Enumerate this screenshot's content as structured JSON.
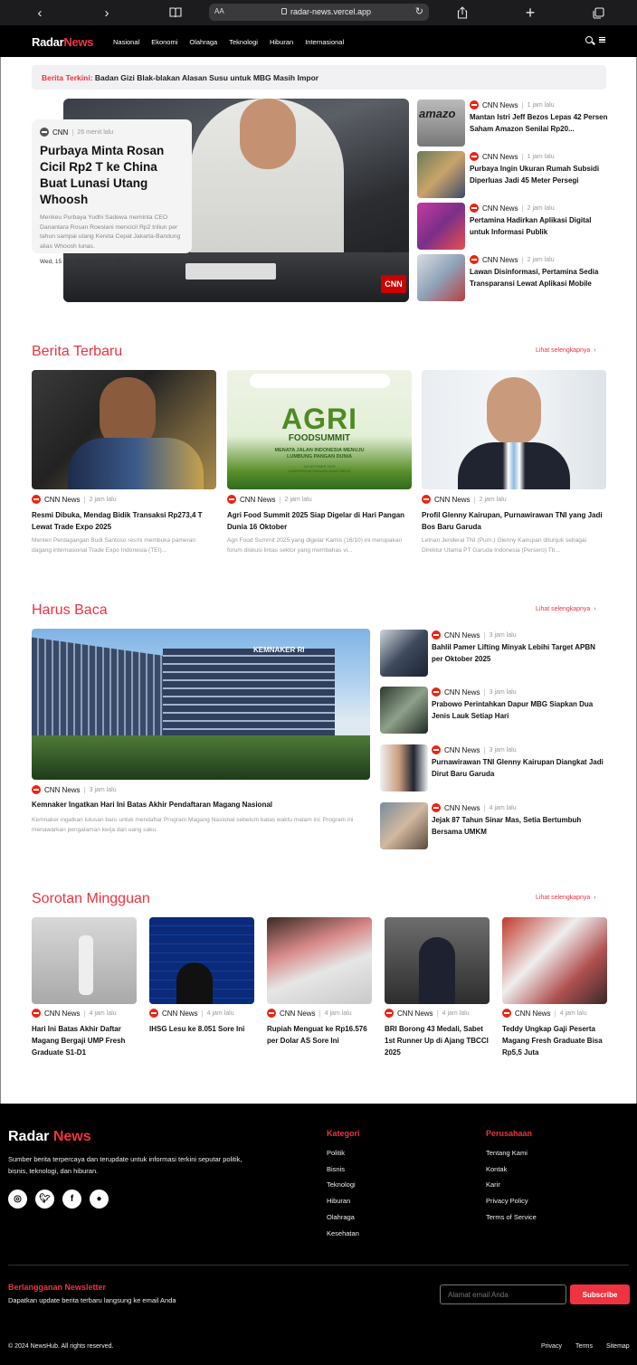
{
  "browser": {
    "aa": "AA",
    "url": "radar-news.vercel.app"
  },
  "brand": {
    "name_a": "Radar",
    "name_b": "News",
    "accent": "#ef3340"
  },
  "nav": [
    "Nasional",
    "Ekonomi",
    "Olahraga",
    "Teknologi",
    "Hiburan",
    "Internasional"
  ],
  "breaking": {
    "label": "Berita Terkini:",
    "text": "Badan Gizi Blak-blakan Alasan Susu untuk MBG Masih Impor"
  },
  "hero": {
    "source": "CNN",
    "time": "26 menit lalu",
    "title": "Purbaya Minta Rosan Cicil Rp2 T ke China Buat Lunasi Utang Whoosh",
    "summary": "Menkeu Purbaya Yudhi Sadewa meminta CEO Danantara Rosan Roeslani mencicil Rp2 triliun per tahun sampai utang Kereta Cepat Jakarta-Bandung alias Whoosh lunas.",
    "date": "Wed, 15 Oct 2025 19:52:03 +0700"
  },
  "hero_side": [
    {
      "source": "CNN News",
      "time": "1 jam lalu",
      "title": "Mantan Istri Jeff Bezos Lepas 42 Persen Saham Amazon Senilai Rp20..."
    },
    {
      "source": "CNN News",
      "time": "1 jam lalu",
      "title": "Purbaya Ingin Ukuran Rumah Subsidi Diperluas Jadi 45 Meter Persegi"
    },
    {
      "source": "CNN News",
      "time": "2 jam lalu",
      "title": "Pertamina Hadirkan Aplikasi Digital untuk Informasi Publik"
    },
    {
      "source": "CNN News",
      "time": "2 jam lalu",
      "title": "Lawan Disinformasi, Pertamina Sedia Transparansi Lewat Aplikasi Mobile"
    }
  ],
  "see_all": "Lihat selengkapnya",
  "terbaru": {
    "title": "Berita Terbaru",
    "items": [
      {
        "source": "CNN News",
        "time": "2 jam lalu",
        "title": "Resmi Dibuka, Mendag Bidik Transaksi Rp273,4 T Lewat Trade Expo 2025",
        "summary": "Menteri Perdagangan Budi Santoso resmi membuka pameran dagang internasional Trade Expo Indonesia (TEI)..."
      },
      {
        "source": "CNN News",
        "time": "2 jam lalu",
        "title": "Agri Food Summit 2025 Siap Digelar di Hari Pangan Dunia 16 Oktober",
        "summary": "Agri Food Summit 2025 yang digelar Kamis (16/10) ini merupakan forum diskusi lintas sektor yang membahas vi..."
      },
      {
        "source": "CNN News",
        "time": "2 jam lalu",
        "title": "Profil Glenny Kairupan, Purnawirawan TNI yang Jadi Bos Baru Garuda",
        "summary": "Letnan Jenderal TNI (Purn.) Glenny Kairupan ditunjuk sebagai Direktur Utama PT Garuda Indonesia (Persero) Tb..."
      }
    ]
  },
  "agri": {
    "headline": "AGRI",
    "sub": "FOODSUMMIT",
    "tag": "MENATA JALAN INDONESIA MENUJU LUMBUNG PANGAN DUNIA",
    "date": "16 OKTOBER 2025",
    "venue": "AUDITORIUM MENARA BANK MEGA"
  },
  "harus_baca": {
    "title": "Harus Baca",
    "main": {
      "source": "CNN News",
      "time": "3 jam lalu",
      "title": "Kemnaker Ingatkan Hari Ini Batas Akhir Pendaftaran Magang Nasional",
      "summary": "Kemnaker ingatkan lulusan baru untuk mendaftar Program Magang Nasional sebelum batas waktu malam ini. Program ini menawarkan pengalaman kerja dan uang saku.",
      "building_sign": "KEMNAKER RI"
    },
    "side": [
      {
        "source": "CNN News",
        "time": "3 jam lalu",
        "title": "Bahlil Pamer Lifting Minyak Lebihi Target APBN per Oktober 2025"
      },
      {
        "source": "CNN News",
        "time": "3 jam lalu",
        "title": "Prabowo Perintahkan Dapur MBG Siapkan Dua Jenis Lauk Setiap Hari"
      },
      {
        "source": "CNN News",
        "time": "3 jam lalu",
        "title": "Purnawirawan TNI Glenny Kairupan Diangkat Jadi Dirut Baru Garuda"
      },
      {
        "source": "CNN News",
        "time": "4 jam lalu",
        "title": "Jejak 87 Tahun Sinar Mas, Setia Bertumbuh Bersama UMKM"
      }
    ]
  },
  "sorotan": {
    "title": "Sorotan Mingguan",
    "items": [
      {
        "source": "CNN News",
        "time": "4 jam lalu",
        "title": "Hari Ini Batas Akhir Daftar Magang Bergaji UMP Fresh Graduate S1-D1"
      },
      {
        "source": "CNN News",
        "time": "4 jam lalu",
        "title": "IHSG Lesu ke 8.051 Sore Ini"
      },
      {
        "source": "CNN News",
        "time": "4 jam lalu",
        "title": "Rupiah Menguat ke Rp16.576 per Dolar AS Sore Ini"
      },
      {
        "source": "CNN News",
        "time": "4 jam lalu",
        "title": "BRI Borong 43 Medali, Sabet 1st Runner Up di Ajang TBCCI 2025"
      },
      {
        "source": "CNN News",
        "time": "4 jam lalu",
        "title": "Teddy Ungkap Gaji Peserta Magang Fresh Graduate Bisa Rp5,5 Juta"
      }
    ]
  },
  "footer": {
    "logo_a": "Radar",
    "logo_b": "News",
    "desc": "Sumber berita terpercaya dan terupdate untuk informasi terkini seputar politik, bisnis, teknologi, dan hiburan.",
    "kategori_title": "Kategori",
    "kategori": [
      "Politik",
      "Bisnis",
      "Teknologi",
      "Hiburan",
      "Olahraga",
      "Kesehatan"
    ],
    "perusahaan_title": "Perusahaan",
    "perusahaan": [
      "Tentang Kami",
      "Kontak",
      "Karir",
      "Privacy Policy",
      "Terms of Service"
    ],
    "newsletter_title": "Berlangganan Newsletter",
    "newsletter_desc": "Dapatkan update berita terbaru langsung ke email Anda",
    "email_placeholder": "Alamat email Anda",
    "subscribe": "Subscribe",
    "copyright": "© 2024 NewsHub. All rights reserved.",
    "bottom_links": [
      "Privacy",
      "Terms",
      "Sitemap"
    ]
  }
}
